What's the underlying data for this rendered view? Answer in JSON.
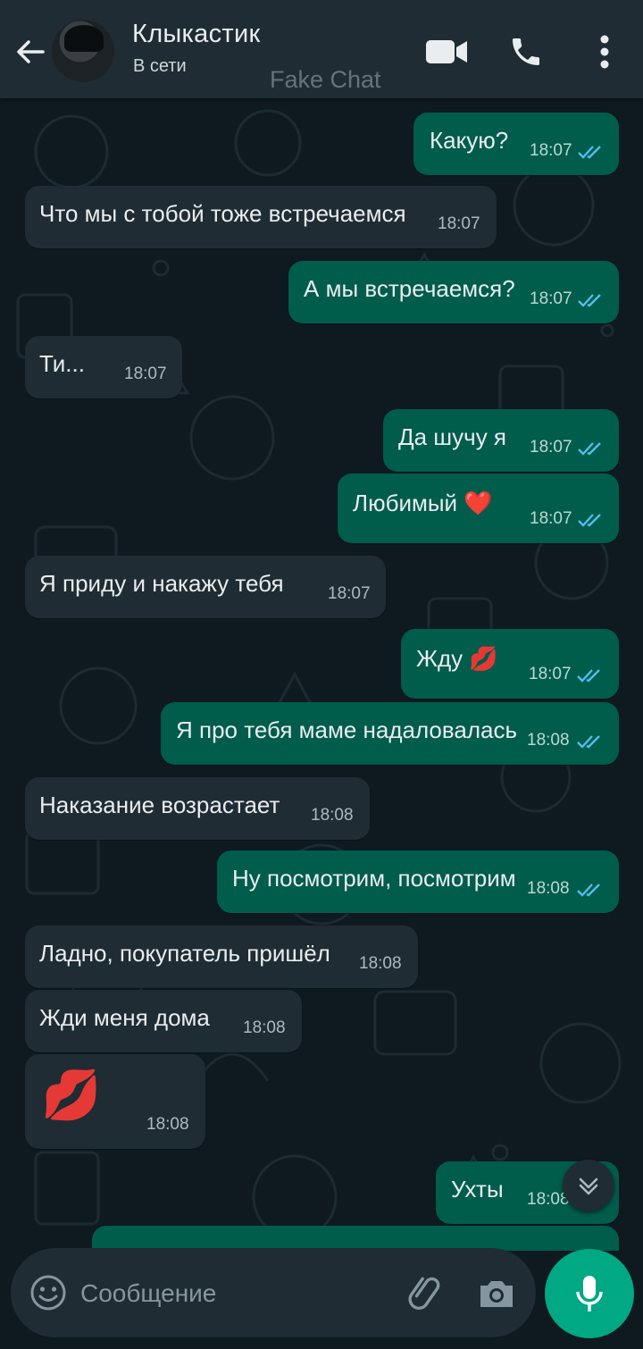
{
  "header": {
    "back_icon": "arrow-left-icon",
    "contact_name": "Клыкастик",
    "status": "В сети",
    "watermark": "Fake Chat",
    "icons": [
      "video-call-icon",
      "phone-icon",
      "more-vert-icon"
    ]
  },
  "messages": [
    {
      "dir": "out",
      "text": "Какую?",
      "time": "18:07",
      "read": true
    },
    {
      "dir": "in",
      "text": "Что мы с тобой тоже встречаемся",
      "time": "18:07"
    },
    {
      "dir": "out",
      "text": "А мы встречаемся?",
      "time": "18:07",
      "read": true
    },
    {
      "dir": "in",
      "text": "Ти...",
      "time": "18:07"
    },
    {
      "dir": "out",
      "text": "Да шучу я",
      "time": "18:07",
      "read": true
    },
    {
      "dir": "out",
      "text": "Любимый ❤️",
      "time": "18:07",
      "read": true
    },
    {
      "dir": "in",
      "text": "Я приду и накажу тебя",
      "time": "18:07"
    },
    {
      "dir": "out",
      "text": "Жду 💋",
      "time": "18:07",
      "read": true
    },
    {
      "dir": "out",
      "text": "Я про тебя маме надаловалась",
      "time": "18:08",
      "read": true
    },
    {
      "dir": "in",
      "text": "Наказание возрастает",
      "time": "18:08"
    },
    {
      "dir": "out",
      "text": "Ну посмотрим, посмотрим",
      "time": "18:08",
      "read": true
    },
    {
      "dir": "in",
      "text": "Ладно, покупатель пришёл",
      "time": "18:08"
    },
    {
      "dir": "in",
      "text": "Жди меня дома",
      "time": "18:08"
    },
    {
      "dir": "in",
      "text": "💋",
      "time": "18:08"
    },
    {
      "dir": "out",
      "text": "Ухты",
      "time": "18:08",
      "read": true
    }
  ],
  "composer": {
    "placeholder": "Сообщение",
    "icons": [
      "emoji-icon",
      "attach-icon",
      "camera-icon",
      "mic-icon"
    ]
  },
  "colors": {
    "background": "#0f1a20",
    "header": "#1f2c33",
    "incoming_bubble": "#1f2c33",
    "outgoing_bubble": "#005c4b",
    "accent": "#00a884",
    "read_ticks": "#53bdeb"
  }
}
